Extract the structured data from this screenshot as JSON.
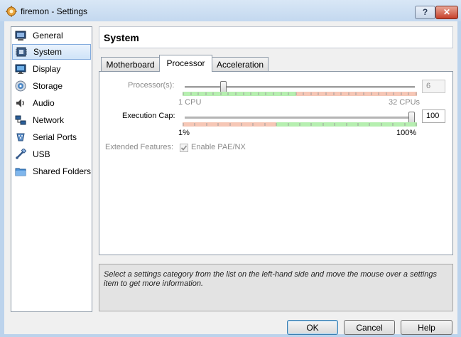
{
  "window": {
    "title": "firemon - Settings",
    "help_label": "?",
    "close_label": "✕"
  },
  "sidebar": {
    "items": [
      {
        "label": "General",
        "icon": "general-icon"
      },
      {
        "label": "System",
        "icon": "system-icon",
        "selected": true
      },
      {
        "label": "Display",
        "icon": "display-icon"
      },
      {
        "label": "Storage",
        "icon": "storage-icon"
      },
      {
        "label": "Audio",
        "icon": "audio-icon"
      },
      {
        "label": "Network",
        "icon": "network-icon"
      },
      {
        "label": "Serial Ports",
        "icon": "serial-ports-icon"
      },
      {
        "label": "USB",
        "icon": "usb-icon"
      },
      {
        "label": "Shared Folders",
        "icon": "shared-folders-icon"
      }
    ]
  },
  "page": {
    "title": "System"
  },
  "tabs": [
    {
      "label": "Motherboard",
      "active": false
    },
    {
      "label": "Processor",
      "active": true
    },
    {
      "label": "Acceleration",
      "active": false
    }
  ],
  "processor": {
    "processors_label": "Processor(s):",
    "processors_value": "6",
    "processors_min_label": "1 CPU",
    "processors_max_label": "32 CPUs",
    "processors_level": 0.16,
    "exec_cap_label": "Execution Cap:",
    "exec_cap_value": "100",
    "exec_cap_min_label": "1%",
    "exec_cap_max_label": "100%",
    "exec_cap_level": 1.0,
    "extended_label": "Extended Features:",
    "pae_label": "Enable PAE/NX",
    "pae_checked": true
  },
  "info": {
    "text": "Select a settings category from the list on the left-hand side and move the mouse over a settings item to get more information."
  },
  "buttons": {
    "ok": "OK",
    "cancel": "Cancel",
    "help": "Help"
  },
  "colors": {
    "green_range": "#b6efb0",
    "red_range": "#f6c7b6",
    "selection": "#cfe3f8"
  }
}
